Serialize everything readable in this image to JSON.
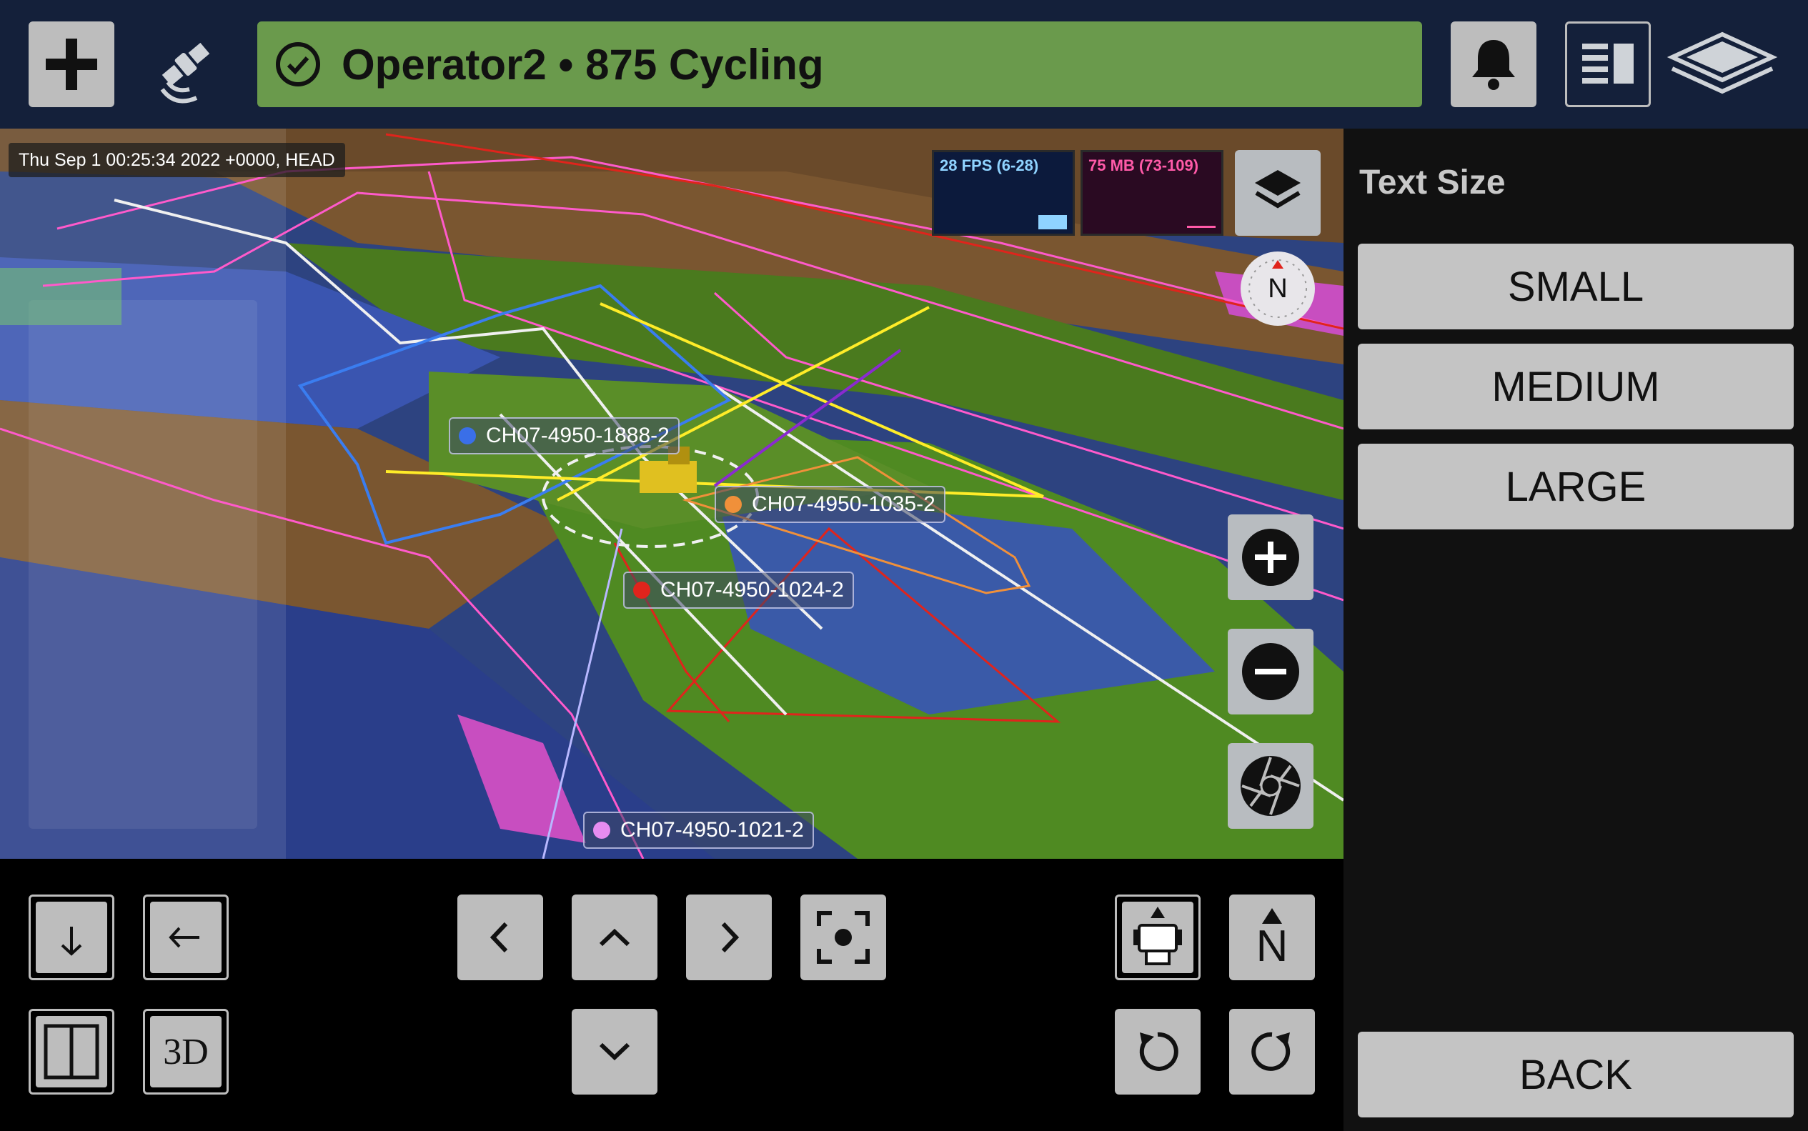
{
  "header": {
    "status_text": "Operator2 • 875 Cycling",
    "colors": {
      "bar": "#14203a",
      "status": "#6a9a4c",
      "button": "#bdbdbd"
    }
  },
  "map": {
    "timestamp": "Thu Sep 1 00:25:34 2022 +0000, HEAD",
    "fps_label": "28 FPS (6-28)",
    "memory_label": "75 MB (73-109)",
    "compass_label": "N",
    "machines": [
      {
        "label": "CH07-4950-1888-2",
        "color": "#3a6fe8"
      },
      {
        "label": "CH07-4950-1035-2",
        "color": "#f0903a"
      },
      {
        "label": "CH07-4950-1024-2",
        "color": "#e0241c"
      },
      {
        "label": "CH07-4950-1021-2",
        "color": "#e68cf0"
      }
    ]
  },
  "controls": {
    "view_3d_label": "3D",
    "north_label": "N"
  },
  "panel": {
    "title": "Text Size",
    "options": [
      "SMALL",
      "MEDIUM",
      "LARGE"
    ],
    "back_label": "BACK"
  }
}
